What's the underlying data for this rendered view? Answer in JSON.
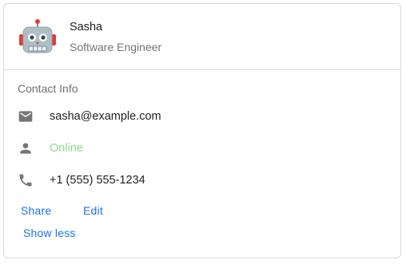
{
  "profile": {
    "name": "Sasha",
    "title": "Software Engineer",
    "avatar_icon": "robot-emoji-icon"
  },
  "contact": {
    "section_label": "Contact Info",
    "email": "sasha@example.com",
    "status": "Online",
    "phone": "+1 (555) 555-1234",
    "email_icon": "mail-icon",
    "status_icon": "person-icon",
    "phone_icon": "phone-icon"
  },
  "actions": {
    "share_label": "Share",
    "edit_label": "Edit",
    "show_less_label": "Show less"
  },
  "colors": {
    "link": "#1a73e8",
    "online": "#8bdc8b",
    "border": "#d9d9d9"
  }
}
